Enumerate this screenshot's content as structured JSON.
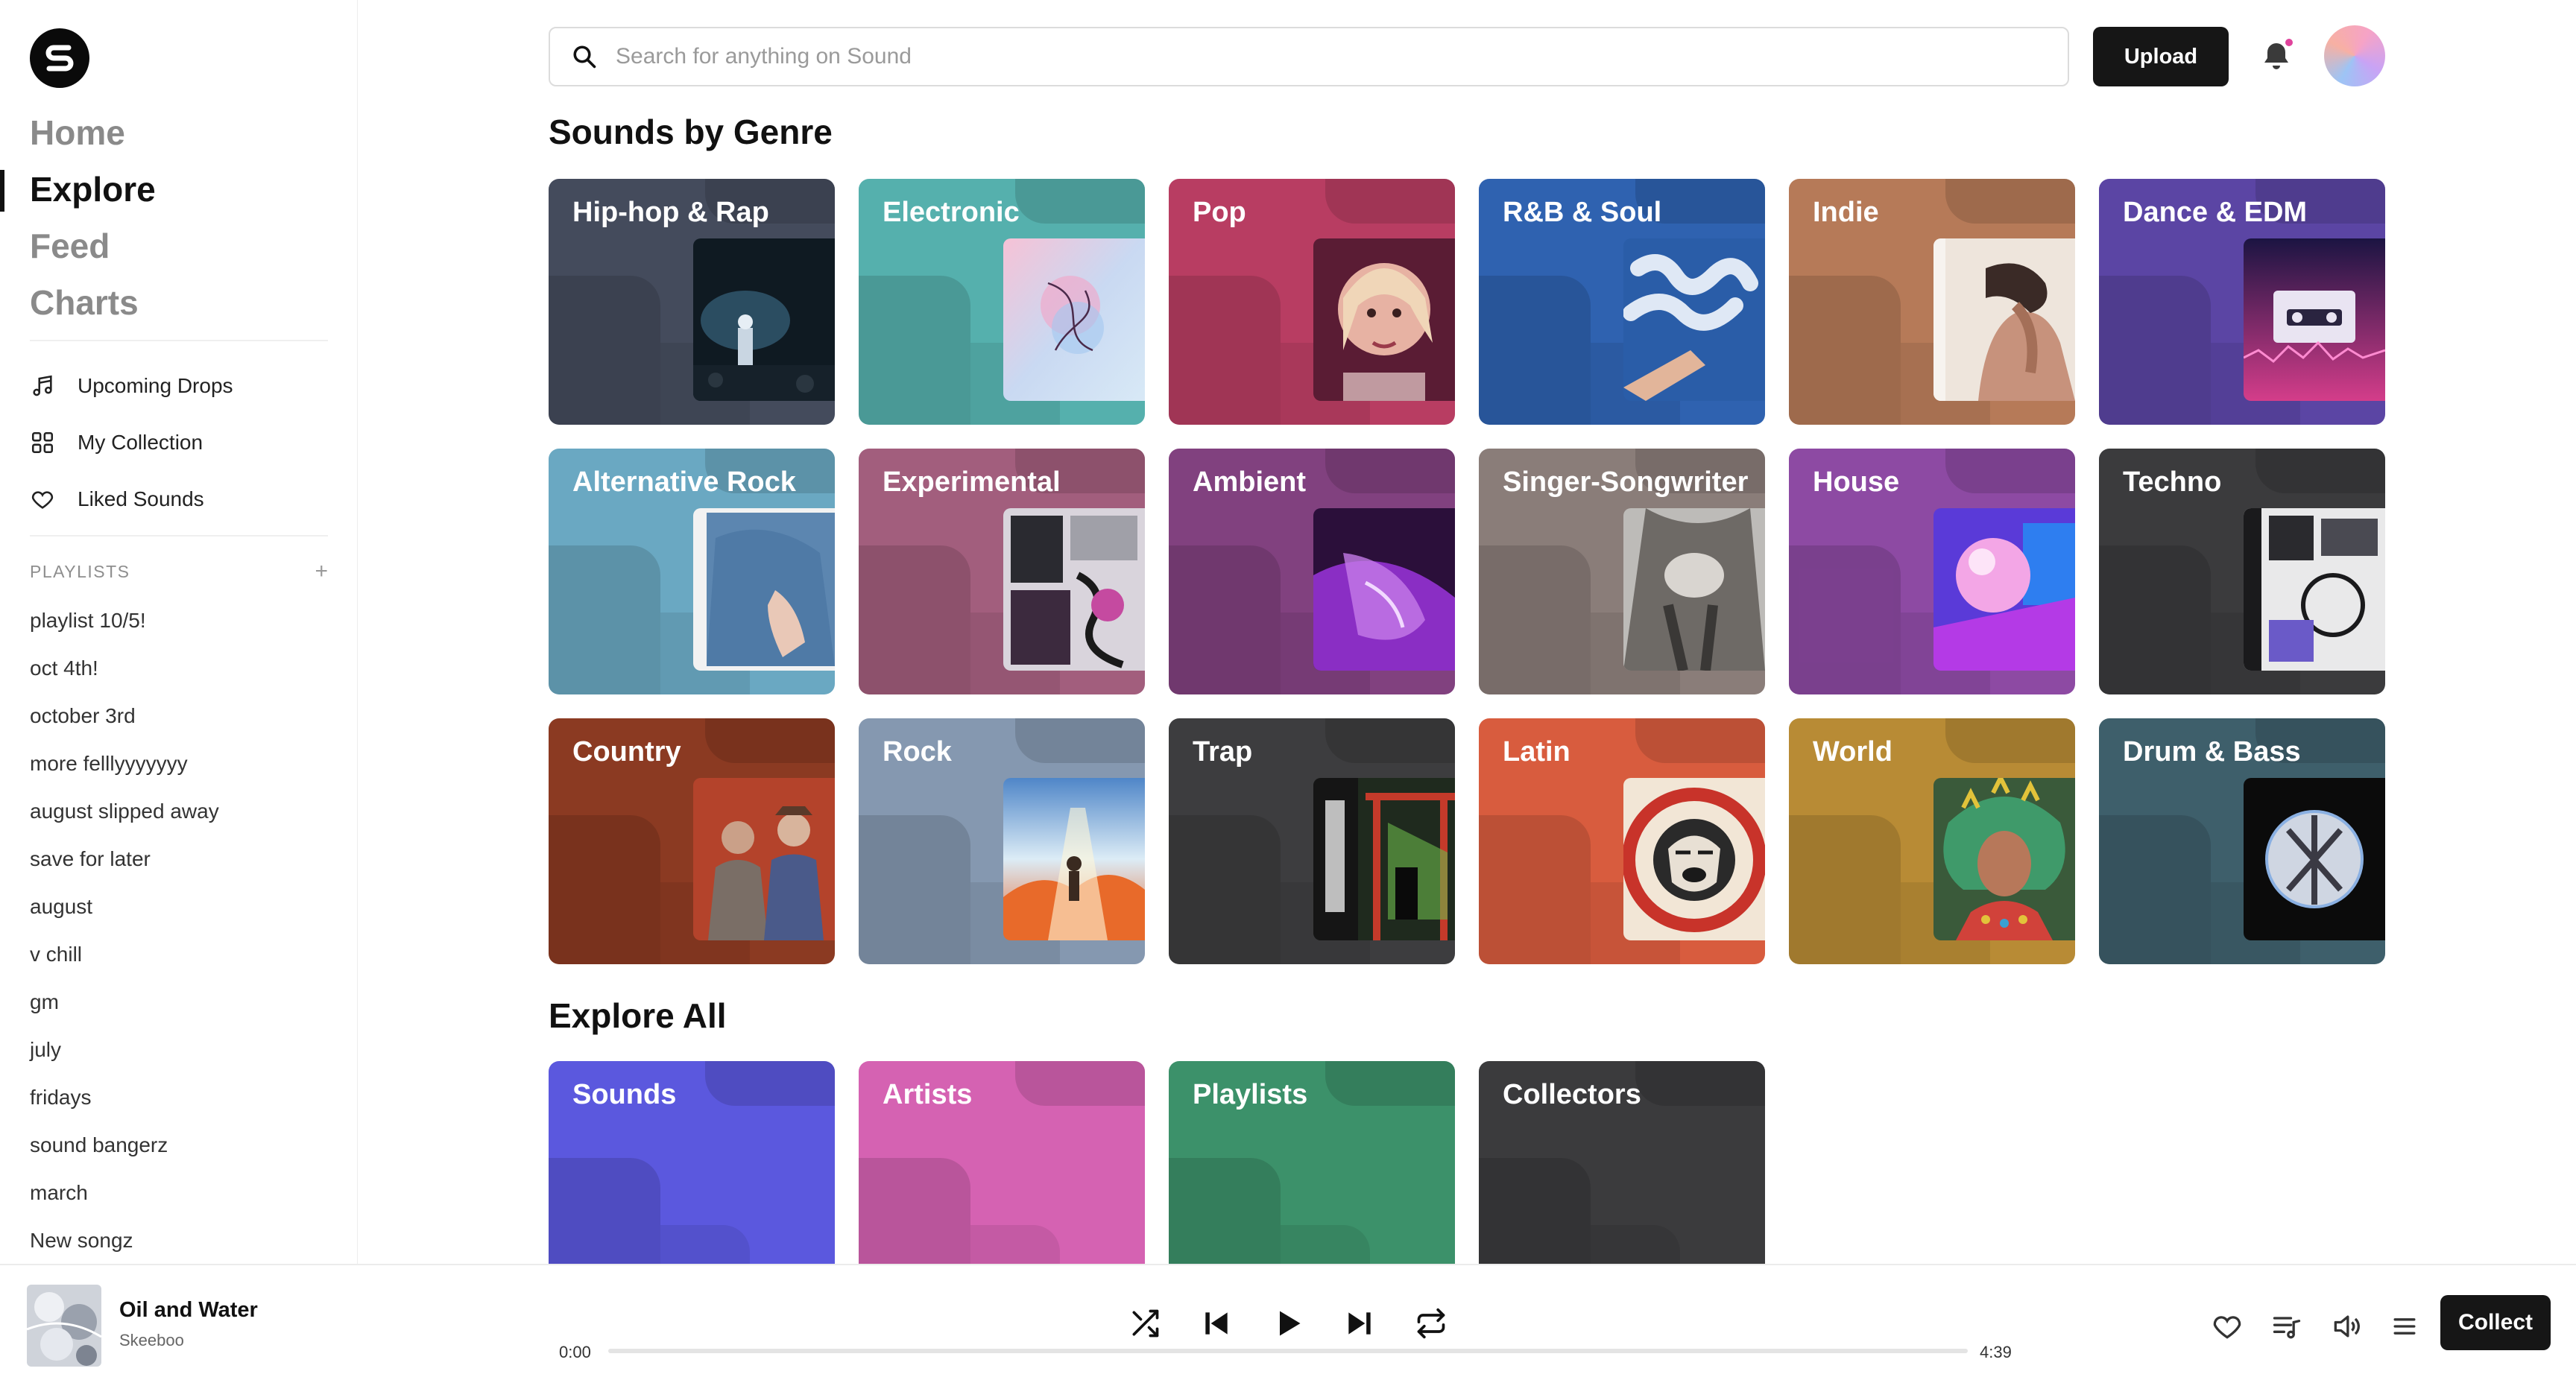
{
  "sidebar": {
    "logo": "sound-logo",
    "nav": [
      {
        "label": "Home"
      },
      {
        "label": "Explore",
        "active": true
      },
      {
        "label": "Feed"
      },
      {
        "label": "Charts"
      }
    ],
    "sub_nav": [
      {
        "label": "Upcoming Drops",
        "icon": "music-note-icon"
      },
      {
        "label": "My Collection",
        "icon": "grid-icon"
      },
      {
        "label": "Liked Sounds",
        "icon": "heart-icon"
      }
    ],
    "playlists_header": "PLAYLISTS",
    "playlists": [
      "playlist 10/5!",
      "oct 4th!",
      "october 3rd",
      "more felllyyyyyyy",
      "august slipped away",
      "save for later",
      "august",
      "v chill",
      "gm",
      "july",
      "fridays",
      "sound bangerz",
      "march",
      "New songz"
    ]
  },
  "header": {
    "search_placeholder": "Search for anything on Sound",
    "upload_label": "Upload"
  },
  "genres_title": "Sounds by Genre",
  "genres": [
    {
      "label": "Hip-hop & Rap",
      "color": "#444b5c"
    },
    {
      "label": "Electronic",
      "color": "#55b0ad"
    },
    {
      "label": "Pop",
      "color": "#b83d62"
    },
    {
      "label": "R&B & Soul",
      "color": "#2f62b0"
    },
    {
      "label": "Indie",
      "color": "#b67a58"
    },
    {
      "label": "Dance & EDM",
      "color": "#5b45a4"
    },
    {
      "label": "Alternative Rock",
      "color": "#6aa8c2"
    },
    {
      "label": "Experimental",
      "color": "#a25e7d"
    },
    {
      "label": "Ambient",
      "color": "#81417f"
    },
    {
      "label": "Singer-Songwriter",
      "color": "#8a7d79"
    },
    {
      "label": "House",
      "color": "#8d4aa3"
    },
    {
      "label": "Techno",
      "color": "#3b3b3d"
    },
    {
      "label": "Country",
      "color": "#8b3a22"
    },
    {
      "label": "Rock",
      "color": "#8598b0"
    },
    {
      "label": "Trap",
      "color": "#3d3d3f"
    },
    {
      "label": "Latin",
      "color": "#d85c3e"
    },
    {
      "label": "World",
      "color": "#b88b35"
    },
    {
      "label": "Drum & Bass",
      "color": "#3e5f6b"
    }
  ],
  "explore_title": "Explore All",
  "explore": [
    {
      "label": "Sounds",
      "color": "#5b58de"
    },
    {
      "label": "Artists",
      "color": "#d562b2"
    },
    {
      "label": "Playlists",
      "color": "#3c916a"
    },
    {
      "label": "Collectors",
      "color": "#3b3b3d"
    }
  ],
  "player": {
    "title": "Oil and Water",
    "artist": "Skeeboo",
    "current_time": "0:00",
    "duration": "4:39",
    "progress": 0,
    "collect_label": "Collect"
  }
}
